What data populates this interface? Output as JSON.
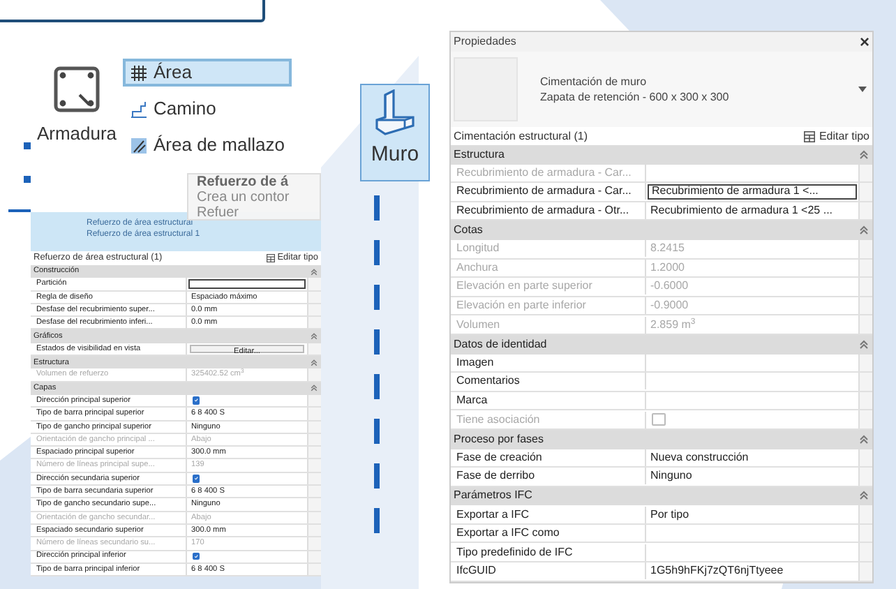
{
  "left_panel": {
    "ribbon": {
      "main_button": {
        "label": "Armadura"
      },
      "items": [
        {
          "label": "Área",
          "selected": true
        },
        {
          "label": "Camino",
          "selected": false
        },
        {
          "label": "Área de mallazo",
          "selected": false
        }
      ],
      "tooltip": {
        "title": "Refuerzo de á",
        "lines": [
          "Crea un contor",
          "Refuer"
        ]
      }
    },
    "type_preview": [
      "Refuerzo de área estructural",
      "Refuerzo de área estructural 1"
    ],
    "properties": {
      "selector": "Refuerzo de área estructural (1)",
      "edit_type": "Editar tipo",
      "groups": [
        {
          "name": "Construcción",
          "rows": [
            {
              "label": "Partición",
              "value": "",
              "kind": "field",
              "disabled": false
            },
            {
              "label": "Regla de diseño",
              "value": "Espaciado máximo",
              "kind": "text",
              "disabled": false
            },
            {
              "label": "Desfase del recubrimiento super...",
              "value": "0.0 mm",
              "kind": "text",
              "disabled": false
            },
            {
              "label": "Desfase del recubrimiento inferi...",
              "value": "0.0 mm",
              "kind": "text",
              "disabled": false
            }
          ]
        },
        {
          "name": "Gráficos",
          "rows": [
            {
              "label": "Estados de visibilidad en vista",
              "value": "Editar...",
              "kind": "button",
              "disabled": false
            }
          ]
        },
        {
          "name": "Estructura",
          "rows": [
            {
              "label": "Volumen de refuerzo",
              "value": "325402.52 cm$^{3}$",
              "kind": "text",
              "disabled": true
            }
          ]
        },
        {
          "name": "Capas",
          "rows": [
            {
              "label": "Dirección principal superior",
              "kind": "checkbox",
              "checked": true,
              "disabled": false
            },
            {
              "label": "Tipo de barra principal superior",
              "value": "6 8 400 S",
              "kind": "text",
              "disabled": false
            },
            {
              "label": "Tipo de gancho principal superior",
              "value": "Ninguno",
              "kind": "text",
              "disabled": false
            },
            {
              "label": "Orientación de gancho principal ...",
              "value": "Abajo",
              "kind": "text",
              "disabled": true
            },
            {
              "label": "Espaciado principal superior",
              "value": "300.0 mm",
              "kind": "text",
              "disabled": false
            },
            {
              "label": "Número de líneas principal supe...",
              "value": "139",
              "kind": "text",
              "disabled": true
            },
            {
              "label": "Dirección secundaria superior",
              "kind": "checkbox",
              "checked": true,
              "disabled": false
            },
            {
              "label": "Tipo de barra secundaria superior",
              "value": "6 8 400 S",
              "kind": "text",
              "disabled": false
            },
            {
              "label": "Tipo de gancho secundario supe...",
              "value": "Ninguno",
              "kind": "text",
              "disabled": false
            },
            {
              "label": "Orientación de gancho secundar...",
              "value": "Abajo",
              "kind": "text",
              "disabled": true
            },
            {
              "label": "Espaciado secundario superior",
              "value": "300.0 mm",
              "kind": "text",
              "disabled": false
            },
            {
              "label": "Número de líneas secundario su...",
              "value": "170",
              "kind": "text",
              "disabled": true
            },
            {
              "label": "Dirección principal inferior",
              "kind": "checkbox",
              "checked": true,
              "disabled": false
            },
            {
              "label": "Tipo de barra principal inferior",
              "value": "6 8 400 S",
              "kind": "text",
              "disabled": false
            }
          ]
        }
      ]
    }
  },
  "right_panel": {
    "tool_button": {
      "label": "Muro",
      "selected": true
    },
    "properties": {
      "title": "Propiedades",
      "close": "×",
      "type_preview": [
        "Cimentación de muro",
        "Zapata de retención - 600 x 300 x 300"
      ],
      "selector": "Cimentación estructural (1)",
      "edit_type": "Editar tipo",
      "groups": [
        {
          "name": "Estructura",
          "rows": [
            {
              "label": "Recubrimiento de armadura - Car...",
              "value": "",
              "kind": "text",
              "disabled": true
            },
            {
              "label": "Recubrimiento de armadura - Car...",
              "value": "Recubrimiento de armadura 1 <...",
              "kind": "field",
              "disabled": false
            },
            {
              "label": "Recubrimiento de armadura - Otr...",
              "value": "Recubrimiento de armadura 1 <25 ...",
              "kind": "text",
              "disabled": false
            }
          ]
        },
        {
          "name": "Cotas",
          "rows": [
            {
              "label": "Longitud",
              "value": "8.2415",
              "kind": "text",
              "disabled": true
            },
            {
              "label": "Anchura",
              "value": "1.2000",
              "kind": "text",
              "disabled": true
            },
            {
              "label": "Elevación en parte superior",
              "value": "-0.6000",
              "kind": "text",
              "disabled": true
            },
            {
              "label": "Elevación en parte inferior",
              "value": "-0.9000",
              "kind": "text",
              "disabled": true
            },
            {
              "label": "Volumen",
              "value": "2.859 m$^{3}$",
              "kind": "text",
              "disabled": true
            }
          ]
        },
        {
          "name": "Datos de identidad",
          "rows": [
            {
              "label": "Imagen",
              "value": "",
              "kind": "text",
              "disabled": false
            },
            {
              "label": "Comentarios",
              "value": "",
              "kind": "text",
              "disabled": false
            },
            {
              "label": "Marca",
              "value": "",
              "kind": "text",
              "disabled": false
            },
            {
              "label": "Tiene asociación",
              "kind": "checkbox",
              "checked": false,
              "disabled": true
            }
          ]
        },
        {
          "name": "Proceso por fases",
          "rows": [
            {
              "label": "Fase de creación",
              "value": "Nueva construcción",
              "kind": "text",
              "disabled": false
            },
            {
              "label": "Fase de derribo",
              "value": "Ninguno",
              "kind": "text",
              "disabled": false
            }
          ]
        },
        {
          "name": "Parámetros IFC",
          "rows": [
            {
              "label": "Exportar a IFC",
              "value": "Por tipo",
              "kind": "text",
              "disabled": false
            },
            {
              "label": "Exportar a IFC como",
              "value": "",
              "kind": "text",
              "disabled": false
            },
            {
              "label": "Tipo predefinido de IFC",
              "value": "",
              "kind": "text",
              "disabled": false
            },
            {
              "label": "IfcGUID",
              "value": "1G5h9hFKj7zQT6njTtyeee",
              "kind": "text",
              "disabled": false
            }
          ]
        }
      ]
    }
  }
}
